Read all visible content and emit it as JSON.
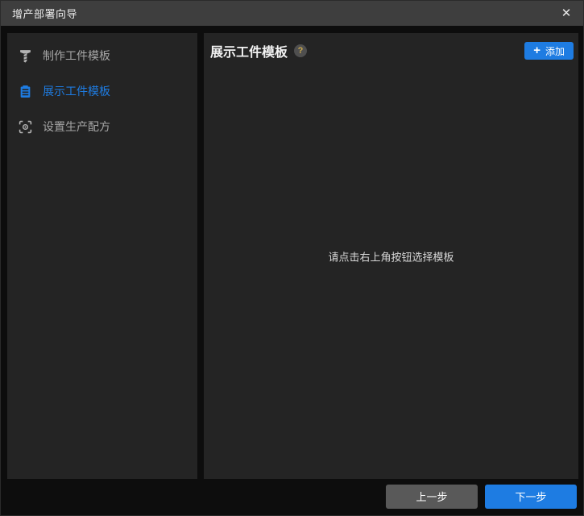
{
  "window": {
    "title": "增产部署向导",
    "close_icon": "✕"
  },
  "sidebar": {
    "items": [
      {
        "label": "制作工件模板",
        "icon": "screw-icon",
        "active": false
      },
      {
        "label": "展示工件模板",
        "icon": "clipboard-icon",
        "active": true
      },
      {
        "label": "设置生产配方",
        "icon": "scan-eye-icon",
        "active": false
      }
    ]
  },
  "main": {
    "title": "展示工件模板",
    "help_icon": "?",
    "add_button_icon": "+",
    "add_button_label": "添加",
    "empty_message": "请点击右上角按钮选择模板"
  },
  "footer": {
    "prev_label": "上一步",
    "next_label": "下一步"
  },
  "colors": {
    "accent_blue": "#1e7ce2",
    "titlebar_grey": "#3e3e3e",
    "panel_grey": "#242424",
    "window_bg": "#0d0d0d",
    "secondary_button_grey": "#595959",
    "help_icon_text": "#c9a94f",
    "inactive_text": "#a6a6a6"
  }
}
